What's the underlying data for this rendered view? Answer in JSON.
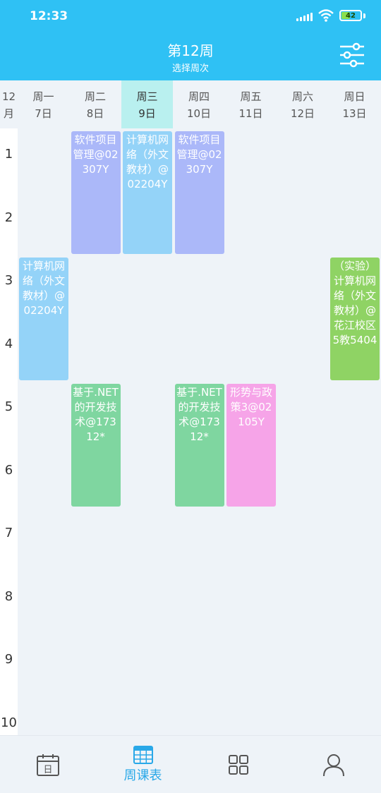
{
  "status_bar": {
    "time": "12:33",
    "battery": "42"
  },
  "header": {
    "title": "第12周",
    "subtitle": "选择周次"
  },
  "month": {
    "line1": "12",
    "line2": "月"
  },
  "days": [
    {
      "weekday": "周一",
      "date": "7日"
    },
    {
      "weekday": "周二",
      "date": "8日"
    },
    {
      "weekday": "周三",
      "date": "9日"
    },
    {
      "weekday": "周四",
      "date": "10日"
    },
    {
      "weekday": "周五",
      "date": "11日"
    },
    {
      "weekday": "周六",
      "date": "12日"
    },
    {
      "weekday": "周日",
      "date": "13日"
    }
  ],
  "today_index": 2,
  "periods": [
    "1",
    "2",
    "3",
    "4",
    "5",
    "6",
    "7",
    "8",
    "9",
    "10"
  ],
  "courses": [
    {
      "day": 1,
      "start": 1,
      "span": 2,
      "text": "软件项目管理@02307Y",
      "color": "#abb8f9"
    },
    {
      "day": 2,
      "start": 1,
      "span": 2,
      "text": "计算机网络（外文教材）@02204Y",
      "color": "#94d3f8"
    },
    {
      "day": 3,
      "start": 1,
      "span": 2,
      "text": "软件项目管理@02307Y",
      "color": "#abb8f9"
    },
    {
      "day": 0,
      "start": 3,
      "span": 2,
      "text": "计算机网络（外文教材）@02204Y",
      "color": "#94d3f8"
    },
    {
      "day": 6,
      "start": 3,
      "span": 2,
      "text": "（实验）计算机网络（外文教材）@花江校区5教5404",
      "color": "#8fd364"
    },
    {
      "day": 1,
      "start": 5,
      "span": 2,
      "text": "基于.NET的开发技术@17312*",
      "color": "#7fd6a0"
    },
    {
      "day": 3,
      "start": 5,
      "span": 2,
      "text": "基于.NET的开发技术@17312*",
      "color": "#7fd6a0"
    },
    {
      "day": 4,
      "start": 5,
      "span": 2,
      "text": "形势与政策3@02105Y",
      "color": "#f6a4e8"
    }
  ],
  "nav": [
    {
      "label": "",
      "icon": "calendar-day-icon"
    },
    {
      "label": "周课表",
      "icon": "week-table-icon"
    },
    {
      "label": "",
      "icon": "apps-grid-icon"
    },
    {
      "label": "",
      "icon": "user-icon"
    }
  ],
  "colors": {
    "primary": "#2fc1f4",
    "today": "#b9f0ef",
    "accent": "#29a8e8"
  }
}
